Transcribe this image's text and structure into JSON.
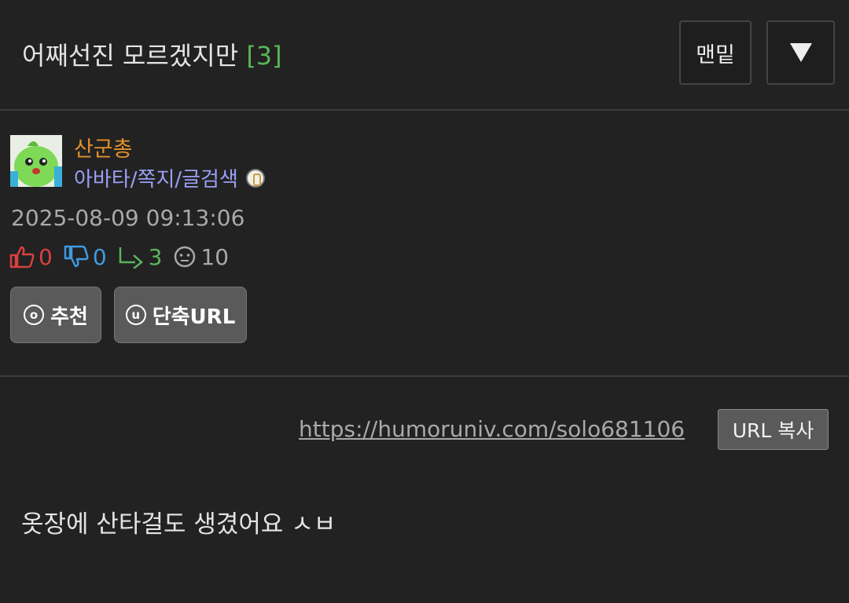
{
  "header": {
    "title": "어째선진 모르겠지만",
    "comment_count": "[3]",
    "bottom_button_label": "맨밑"
  },
  "author": {
    "nickname": "산군총",
    "links_label": "아바타/쪽지/글검색",
    "posted_at": "2025-08-09 09:13:06"
  },
  "stats": {
    "upvotes": "0",
    "downvotes": "0",
    "replies": "3",
    "views": "10"
  },
  "actions": {
    "recommend_label": "추천",
    "recommend_icon_char": "o",
    "short_url_label": "단축URL",
    "short_url_icon_char": "u"
  },
  "share": {
    "url": "https://humoruniv.com/solo681106",
    "copy_label": "URL 복사"
  },
  "post": {
    "body": "옷장에 산타걸도 생겼어요 ㅅㅂ"
  },
  "colors": {
    "background": "#222222",
    "nickname": "#e0922a",
    "links": "#9b9ff5",
    "comment_count": "#5ab45a",
    "upvote": "#d94040",
    "downvote": "#3f9be0",
    "reply": "#5ab45a"
  }
}
